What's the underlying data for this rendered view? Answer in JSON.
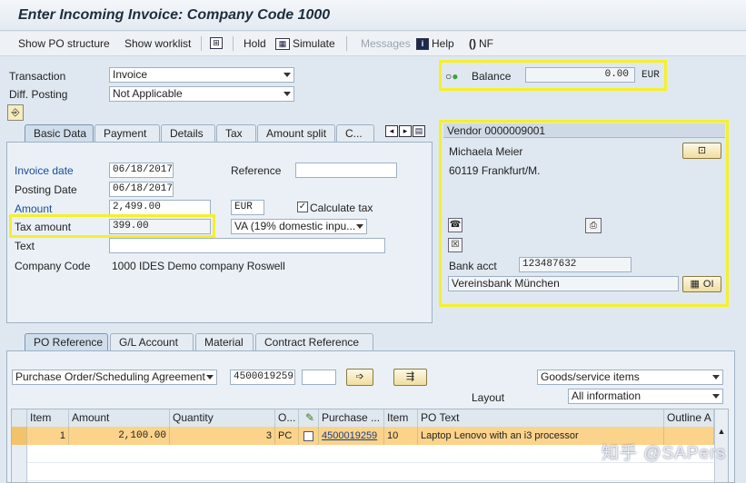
{
  "title": "Enter Incoming Invoice: Company Code 1000",
  "toolbar": {
    "show_po_structure": "Show PO structure",
    "show_worklist": "Show worklist",
    "hold": "Hold",
    "simulate": "Simulate",
    "messages": "Messages",
    "help": "Help",
    "nf": "NF"
  },
  "header": {
    "transaction_label": "Transaction",
    "transaction_value": "Invoice",
    "diff_posting_label": "Diff. Posting",
    "diff_posting_value": "Not Applicable",
    "balance_label": "Balance",
    "balance_value": "0.00",
    "balance_currency": "EUR"
  },
  "tabs": [
    "Basic Data",
    "Payment",
    "Details",
    "Tax",
    "Amount split",
    "C..."
  ],
  "basic": {
    "invoice_date_label": "Invoice date",
    "invoice_date": "06/18/2017",
    "reference_label": "Reference",
    "reference": "",
    "posting_date_label": "Posting Date",
    "posting_date": "06/18/2017",
    "amount_label": "Amount",
    "amount": "2,499.00",
    "amount_currency": "EUR",
    "calc_tax_label": "Calculate tax",
    "tax_amount_label": "Tax amount",
    "tax_amount": "399.00",
    "tax_code": "VA (19% domestic inpu...",
    "text_label": "Text",
    "text": "",
    "company_code_label": "Company Code",
    "company_code": "1000 IDES Demo company Roswell"
  },
  "vendor": {
    "header": "Vendor 0000009001",
    "name": "Michaela Meier",
    "city": "60119 Frankfurt/M.",
    "bank_acct_label": "Bank acct",
    "bank_acct": "123487632",
    "bank_name": "Vereinsbank München",
    "oi_label": "OI"
  },
  "lower_tabs": [
    "PO Reference",
    "G/L Account",
    "Material",
    "Contract Reference"
  ],
  "po": {
    "ref_type": "Purchase Order/Scheduling Agreement",
    "po_number": "4500019259",
    "item_type": "Goods/service items",
    "layout_label": "Layout",
    "layout_value": "All information"
  },
  "grid": {
    "columns": [
      "Item",
      "Amount",
      "Quantity",
      "O...",
      "",
      "Purchase ...",
      "Item",
      "PO Text",
      "Outline A"
    ],
    "rows": [
      {
        "item": "1",
        "amount": "2,100.00",
        "quantity": "3",
        "unit": "PC",
        "po": "4500019259",
        "po_item": "10",
        "text": "Laptop Lenovo with an i3 processor"
      }
    ]
  },
  "watermark": "知乎 @SAPers",
  "colors": {
    "highlight": "#f5f02a",
    "row_highlight": "#fbd38a",
    "label_blue": "#1a4c9c"
  }
}
